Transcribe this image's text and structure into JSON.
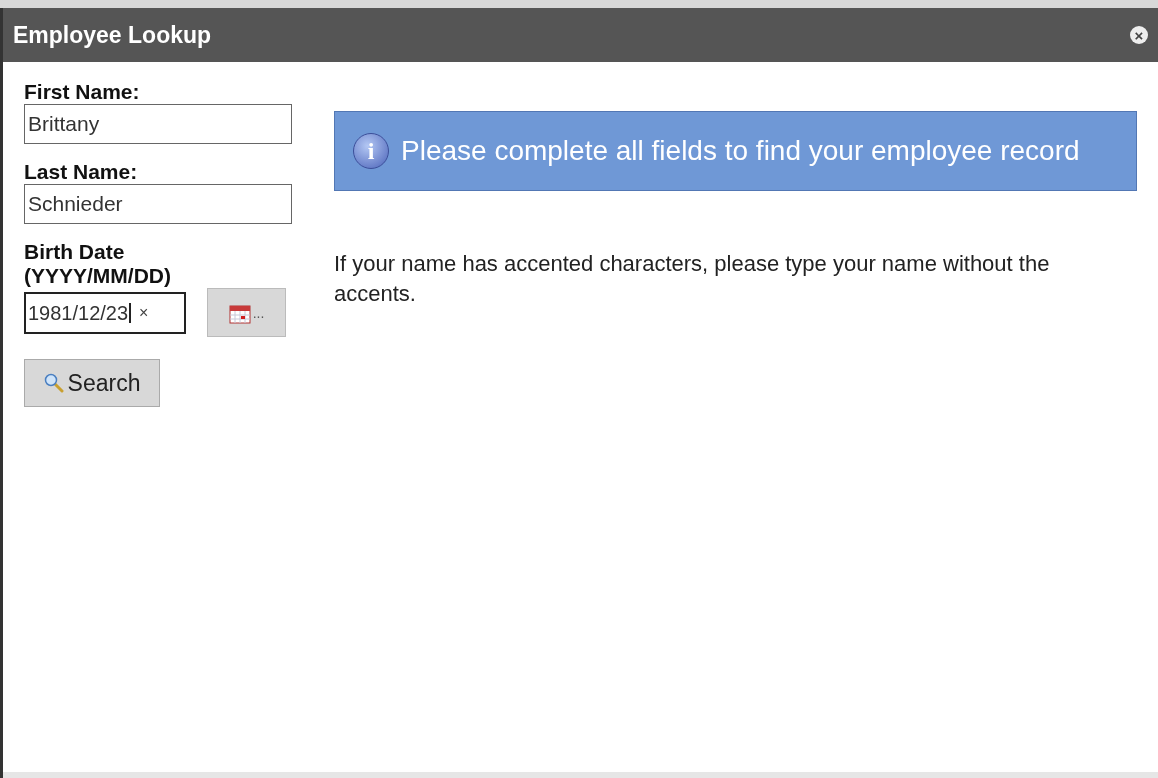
{
  "window": {
    "title": "Employee Lookup",
    "close": "×"
  },
  "form": {
    "fields": [
      {
        "kind": "text",
        "label": "First Name:",
        "value": "Brittany"
      },
      {
        "kind": "text",
        "label": "Last Name:",
        "value": "Schnieder"
      },
      {
        "kind": "date",
        "label": "Birth Date (YYYY/MM/DD)",
        "value": "1981/12/23",
        "clear": "×",
        "picker": "..."
      }
    ],
    "search_button": "Search"
  },
  "info_banner": {
    "icon": "i",
    "text": "Please complete all fields to find your employee record"
  },
  "note": "If your name has accented characters, please type your name without the accents."
}
